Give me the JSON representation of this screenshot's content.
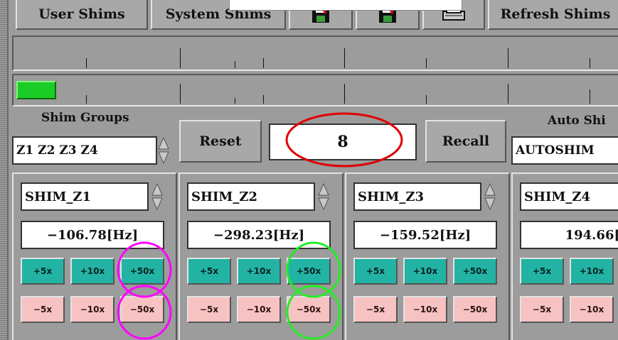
{
  "toolbar": {
    "user_shims": "User Shims",
    "system_shims": "System Shims",
    "save_icon_1": "save-red-icon",
    "save_icon_2": "save-icon",
    "printer_icon": "printer-icon",
    "refresh_shims": "Refresh Shims"
  },
  "shim_groups": {
    "label": "Shim Groups",
    "value": "Z1 Z2 Z3 Z4"
  },
  "controls": {
    "reset": "Reset",
    "counter_value": "8",
    "recall": "Recall"
  },
  "auto_shim": {
    "label": "Auto Shi",
    "value": "AUTOSHIM"
  },
  "panels": [
    {
      "name": "SHIM_Z1",
      "value": "−106.78[Hz]",
      "plus": [
        "+5x",
        "+10x",
        "+50x"
      ],
      "minus": [
        "−5x",
        "−10x",
        "−50x"
      ]
    },
    {
      "name": "SHIM_Z2",
      "value": "−298.23[Hz]",
      "plus": [
        "+5x",
        "+10x",
        "+50x"
      ],
      "minus": [
        "−5x",
        "−10x",
        "−50x"
      ]
    },
    {
      "name": "SHIM_Z3",
      "value": "−159.52[Hz]",
      "plus": [
        "+5x",
        "+10x",
        "+50x"
      ],
      "minus": [
        "−5x",
        "−10x",
        "−50x"
      ]
    },
    {
      "name": "SHIM_Z4",
      "value": "194.66[H",
      "plus": [
        "+5x",
        "+10x"
      ],
      "minus": [
        "−5x",
        "−10x"
      ]
    }
  ],
  "colors": {
    "highlight_red": "#e00000",
    "highlight_magenta": "#ff00ff",
    "highlight_green": "#22ee22",
    "led_green": "#1bcc26",
    "plus_button": "#23b3a5",
    "minus_button": "#f7c2c2"
  }
}
